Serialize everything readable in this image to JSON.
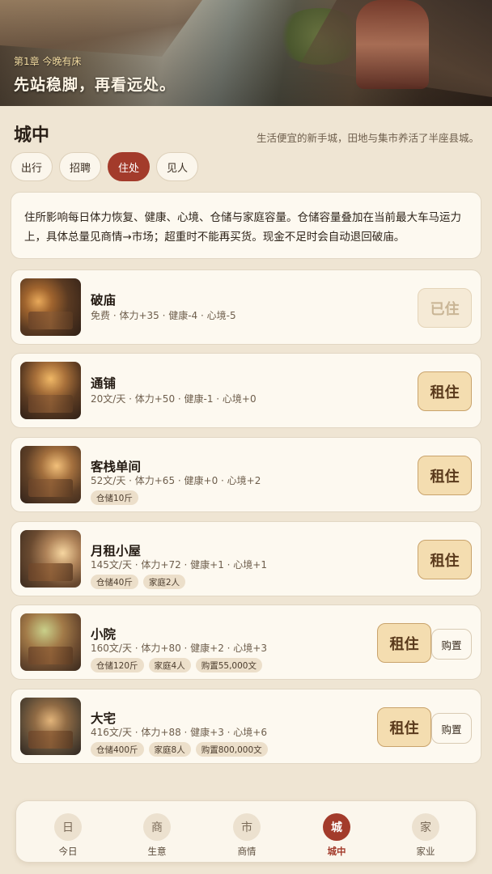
{
  "banner": {
    "chapter": "第1章 今晚有床",
    "motto": "先站稳脚，再看远处。"
  },
  "header": {
    "title": "城中",
    "description": "生活便宜的新手城，田地与集市养活了半座县城。"
  },
  "tabs": [
    {
      "label": "出行",
      "active": false
    },
    {
      "label": "招聘",
      "active": false
    },
    {
      "label": "住处",
      "active": true
    },
    {
      "label": "见人",
      "active": false
    }
  ],
  "info": "住所影响每日体力恢复、健康、心境、仓储与家庭容量。仓储容量叠加在当前最大车马运力上，具体总量见商情→市场；超重时不能再买货。现金不足时会自动退回破庙。",
  "lodgings": [
    {
      "name": "破庙",
      "stats": "免费 · 体力+35 · 健康-4 · 心境-5",
      "chips": [],
      "rent_label": "已住",
      "buy_label": null
    },
    {
      "name": "通铺",
      "stats": "20文/天 · 体力+50 · 健康-1 · 心境+0",
      "chips": [],
      "rent_label": "租住",
      "buy_label": null
    },
    {
      "name": "客栈单间",
      "stats": "52文/天 · 体力+65 · 健康+0 · 心境+2",
      "chips": [
        "仓储10斤"
      ],
      "rent_label": "租住",
      "buy_label": null
    },
    {
      "name": "月租小屋",
      "stats": "145文/天 · 体力+72 · 健康+1 · 心境+1",
      "chips": [
        "仓储40斤",
        "家庭2人"
      ],
      "rent_label": "租住",
      "buy_label": null
    },
    {
      "name": "小院",
      "stats": "160文/天 · 体力+80 · 健康+2 · 心境+3",
      "chips": [
        "仓储120斤",
        "家庭4人",
        "购置55,000文"
      ],
      "rent_label": "租住",
      "buy_label": "购置"
    },
    {
      "name": "大宅",
      "stats": "416文/天 · 体力+88 · 健康+3 · 心境+6",
      "chips": [
        "仓储400斤",
        "家庭8人",
        "购置800,000文"
      ],
      "rent_label": "租住",
      "buy_label": "购置"
    }
  ],
  "nav": [
    {
      "icon": "日",
      "label": "今日",
      "active": false
    },
    {
      "icon": "商",
      "label": "生意",
      "active": false
    },
    {
      "icon": "市",
      "label": "商情",
      "active": false
    },
    {
      "icon": "城",
      "label": "城中",
      "active": true
    },
    {
      "icon": "家",
      "label": "家业",
      "active": false
    }
  ],
  "colors": {
    "accent": "#a33b2b",
    "background": "#efe5d3",
    "card": "#fdf9f0",
    "rent_button": "#f4ddb0"
  }
}
